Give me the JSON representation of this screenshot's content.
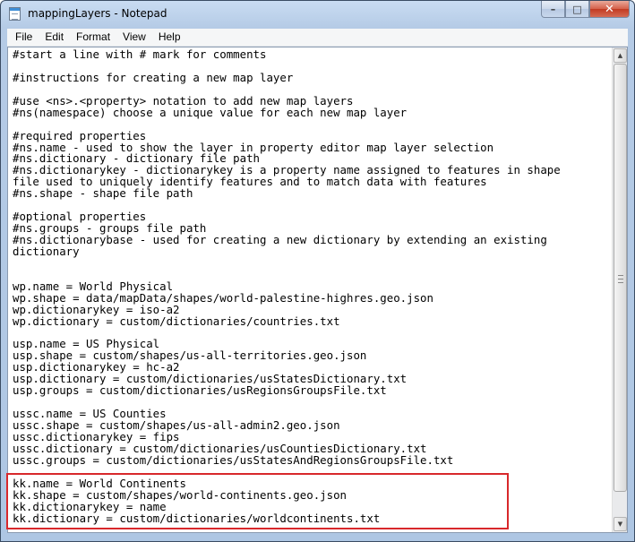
{
  "window": {
    "title": "mappingLayers - Notepad"
  },
  "caption_buttons": {
    "minimize": "–",
    "maximize": "□",
    "close": "✕"
  },
  "menu": [
    "File",
    "Edit",
    "Format",
    "View",
    "Help"
  ],
  "icons": {
    "app": "notepad-icon",
    "scroll_up": "▲",
    "scroll_down": "▼"
  },
  "colors": {
    "highlight": "#d8282b"
  },
  "editor": {
    "lines": [
      "#start a line with # mark for comments",
      "",
      "#instructions for creating a new map layer",
      "",
      "#use <ns>.<property> notation to add new map layers",
      "#ns(namespace) choose a unique value for each new map layer",
      "",
      "#required properties",
      "#ns.name - used to show the layer in property editor map layer selection",
      "#ns.dictionary - dictionary file path",
      "#ns.dictionarykey - dictionarykey is a property name assigned to features in shape",
      "file used to uniquely identify features and to match data with features",
      "#ns.shape - shape file path",
      "",
      "#optional properties",
      "#ns.groups - groups file path",
      "#ns.dictionarybase - used for creating a new dictionary by extending an existing",
      "dictionary",
      "",
      "",
      "wp.name = World Physical",
      "wp.shape = data/mapData/shapes/world-palestine-highres.geo.json",
      "wp.dictionarykey = iso-a2",
      "wp.dictionary = custom/dictionaries/countries.txt",
      "",
      "usp.name = US Physical",
      "usp.shape = custom/shapes/us-all-territories.geo.json",
      "usp.dictionarykey = hc-a2",
      "usp.dictionary = custom/dictionaries/usStatesDictionary.txt",
      "usp.groups = custom/dictionaries/usRegionsGroupsFile.txt",
      "",
      "ussc.name = US Counties",
      "ussc.shape = custom/shapes/us-all-admin2.geo.json",
      "ussc.dictionarykey = fips",
      "ussc.dictionary = custom/dictionaries/usCountiesDictionary.txt",
      "ussc.groups = custom/dictionaries/usStatesAndRegionsGroupsFile.txt",
      "",
      "kk.name = World Continents",
      "kk.shape = custom/shapes/world-continents.geo.json",
      "kk.dictionarykey = name",
      "kk.dictionary = custom/dictionaries/worldcontinents.txt"
    ]
  }
}
